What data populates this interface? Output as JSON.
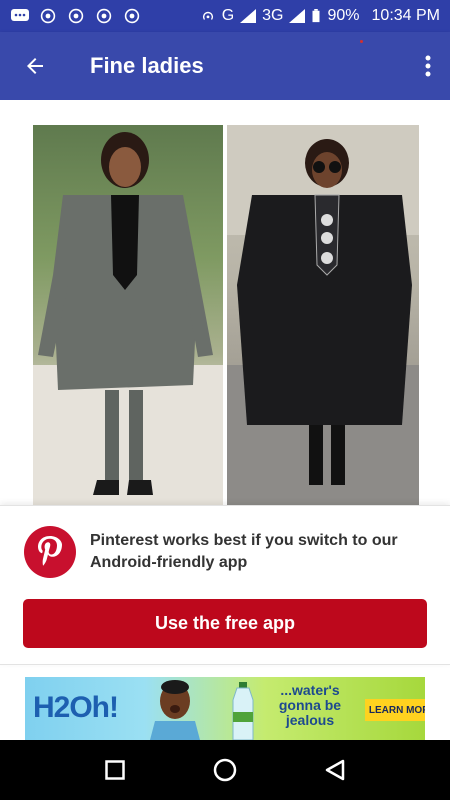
{
  "status_bar": {
    "network": "G",
    "network2": "3G",
    "battery": "90%",
    "time": "10:34 PM"
  },
  "app_bar": {
    "title": "Fine ladies",
    "back_icon": "arrow-back-icon",
    "menu_icon": "more-vert-icon"
  },
  "pinterest_banner": {
    "message": "Pinterest works best if you switch to our Android-friendly app",
    "button_label": "Use the free app",
    "brand_color": "#bd081c"
  },
  "ad": {
    "logo": "H2Oh!",
    "tagline": "...water's gonna be jealous",
    "button_label": "LEARN MORE"
  },
  "nav_bar": {
    "icons": [
      "recents-square-icon",
      "home-circle-icon",
      "back-triangle-icon"
    ]
  },
  "colors": {
    "status_bar": "#2f3fa8",
    "app_bar": "#3949ab"
  }
}
